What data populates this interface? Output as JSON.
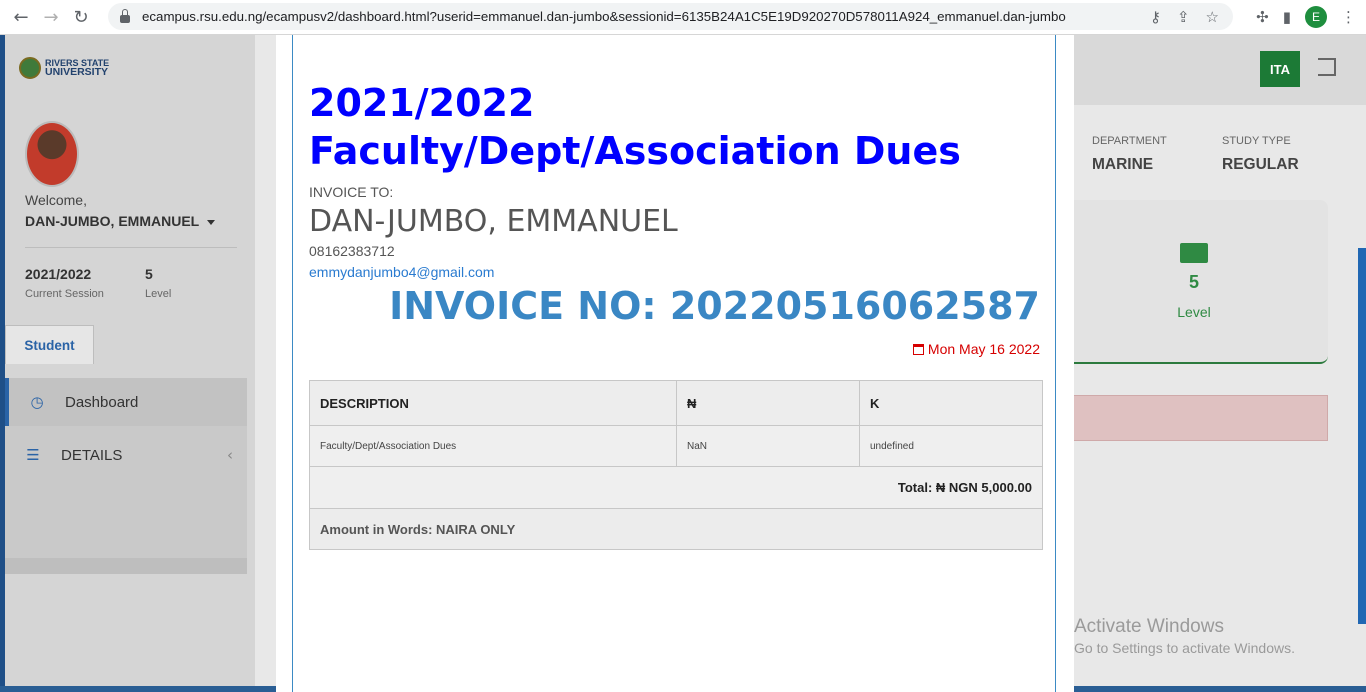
{
  "browser": {
    "url": "ecampus.rsu.edu.ng/ecampusv2/dashboard.html?userid=emmanuel.dan-jumbo&sessionid=6135B24A1C5E19D920270D578011A924_emmanuel.dan-jumbo",
    "profile_initial": "E",
    "back_icon": "←",
    "forward_icon": "→",
    "reload_icon": "↻"
  },
  "sidebar": {
    "logo_line1": "RIVERS STATE",
    "logo_line2": "UNIVERSITY",
    "welcome": "Welcome,",
    "user_name": "DAN-JUMBO, EMMANUEL",
    "session_value": "2021/2022",
    "session_label": "Current Session",
    "level_value": "5",
    "level_label": "Level",
    "tab_label": "Student",
    "menu": [
      {
        "label": "Dashboard",
        "icon": "dashboard-gauge-icon"
      },
      {
        "label": "DETAILS",
        "icon": "list-icon"
      }
    ]
  },
  "header": {
    "user_badge": "ITA",
    "department_label": "DEPARTMENT",
    "department_value": "MARINE",
    "study_type_label": "STUDY TYPE",
    "study_type_value": "REGULAR",
    "level_value": "5",
    "level_label": "Level"
  },
  "watermark": {
    "line1": "Activate Windows",
    "line2": "Go to Settings to activate Windows."
  },
  "invoice": {
    "title_line1": "2021/2022",
    "title_line2": "Faculty/Dept/Association Dues",
    "to_label": "INVOICE TO:",
    "name": "DAN-JUMBO, EMMANUEL",
    "phone": "08162383712",
    "email": "emmydanjumbo4@gmail.com",
    "invoice_no": "INVOICE NO: 20220516062587",
    "date": "Mon May 16 2022",
    "table": {
      "headers": [
        "DESCRIPTION",
        "₦",
        "K"
      ],
      "rows": [
        [
          "Faculty/Dept/Association Dues",
          "NaN",
          "undefined"
        ]
      ],
      "total": "Total: ₦ NGN 5,000.00",
      "amount_in_words": "Amount in Words: NAIRA ONLY"
    }
  },
  "colors": {
    "title_blue": "#0000ff",
    "invoice_no_blue": "#3a87c4",
    "date_red": "#d60000",
    "brand_green": "#1c7a36"
  }
}
